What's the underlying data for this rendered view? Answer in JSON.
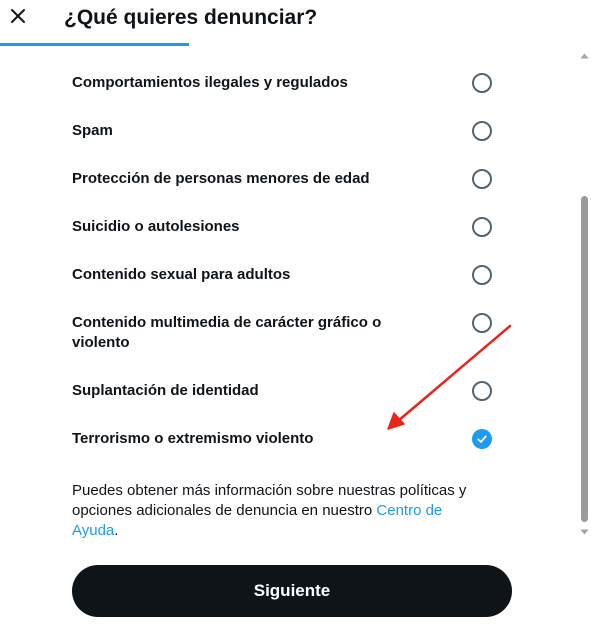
{
  "header": {
    "title": "¿Qué quieres denunciar?",
    "close_icon": "close-icon",
    "progress": 0.32
  },
  "options": [
    {
      "label": "Comportamientos ilegales y regulados",
      "checked": false
    },
    {
      "label": "Spam",
      "checked": false
    },
    {
      "label": "Protección de personas menores de edad",
      "checked": false
    },
    {
      "label": "Suicidio o autolesiones",
      "checked": false
    },
    {
      "label": "Contenido sexual para adultos",
      "checked": false
    },
    {
      "label": "Contenido multimedia de carácter gráfico o violento",
      "checked": false
    },
    {
      "label": "Suplantación de identidad",
      "checked": false
    },
    {
      "label": "Terrorismo o extremismo violento",
      "checked": true
    }
  ],
  "help": {
    "text": "Puedes obtener más información sobre nuestras políticas y opciones adicionales de denuncia en nuestro ",
    "link": "Centro de Ayuda",
    "suffix": "."
  },
  "footer": {
    "next_label": "Siguiente"
  },
  "colors": {
    "accent": "#1d9bf0",
    "text": "#0f1419",
    "button_bg": "#0f1419",
    "annotation": "#e8241b"
  }
}
